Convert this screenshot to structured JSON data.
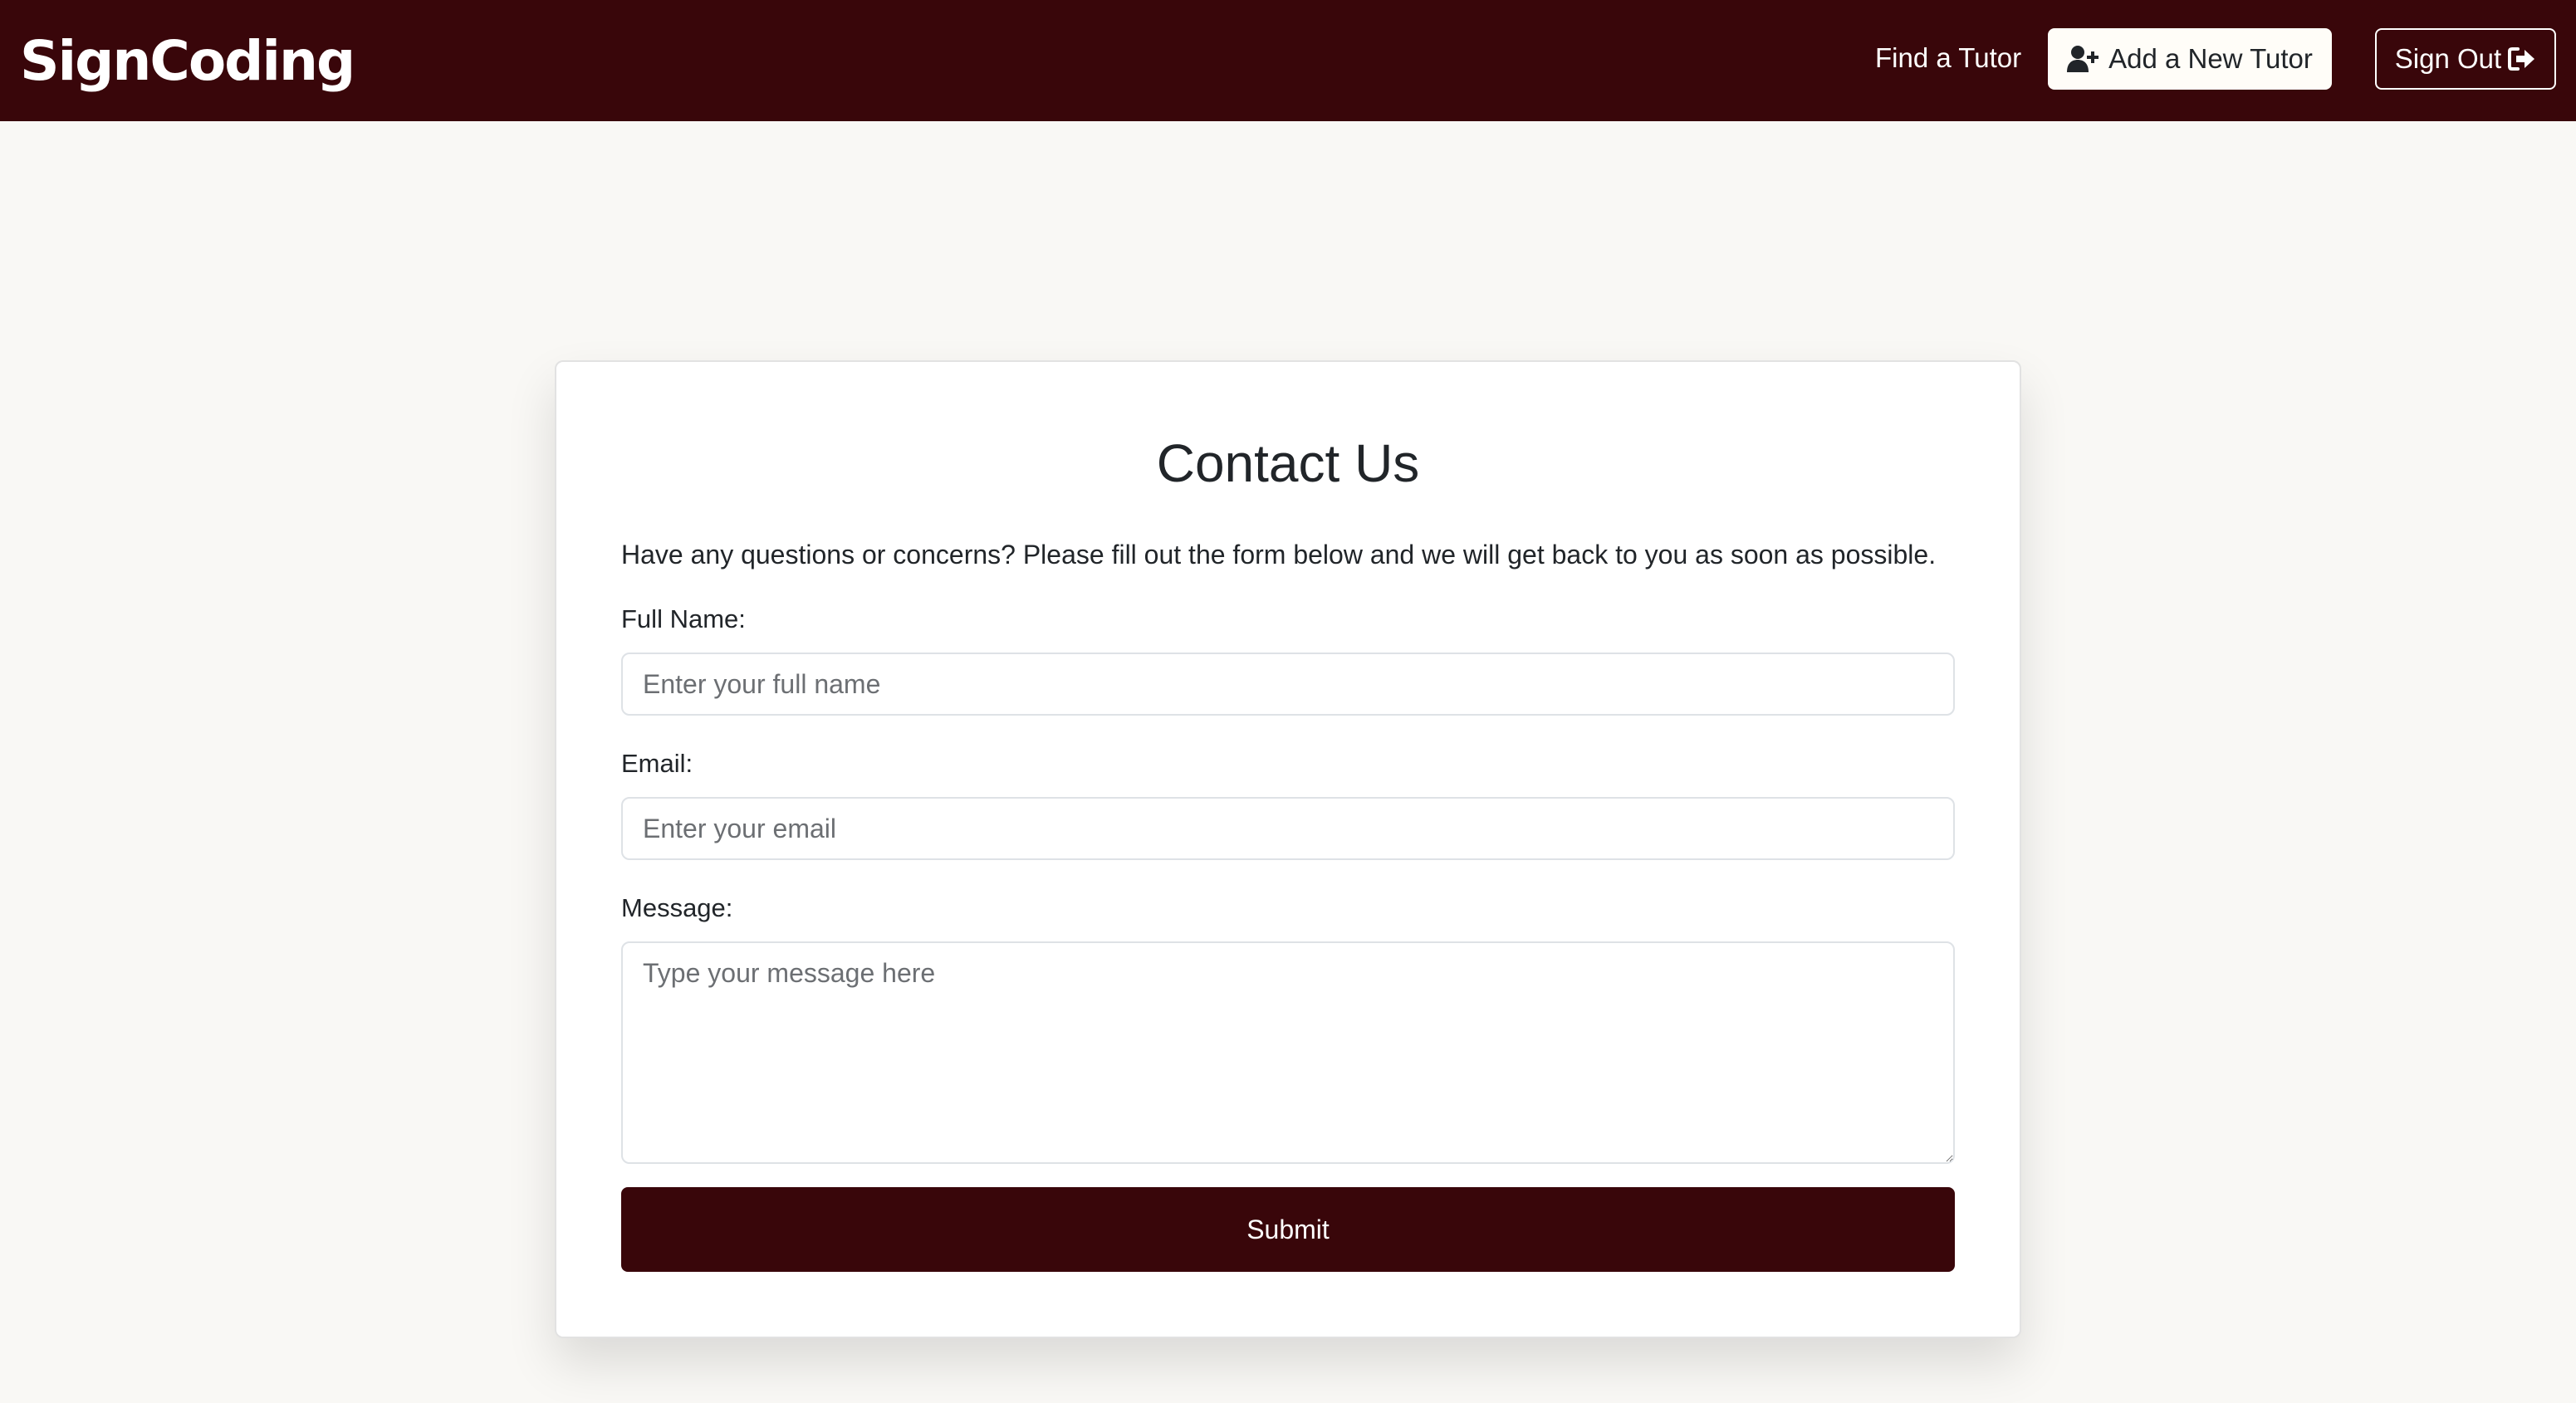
{
  "navbar": {
    "brand": "SignCoding",
    "find_tutor_label": "Find a Tutor",
    "add_tutor_label": "Add a New Tutor",
    "add_tutor_icon": "user-plus-icon",
    "sign_out_label": "Sign Out",
    "sign_out_icon": "sign-out-icon",
    "background_color": "#39060a"
  },
  "contact": {
    "title": "Contact Us",
    "intro": "Have any questions or concerns? Please fill out the form below and we will get back to you as soon as possible.",
    "full_name_label": "Full Name:",
    "full_name_placeholder": "Enter your full name",
    "full_name_value": "",
    "email_label": "Email:",
    "email_placeholder": "Enter your email",
    "email_value": "",
    "message_label": "Message:",
    "message_placeholder": "Type your message here",
    "message_value": "",
    "submit_label": "Submit"
  },
  "colors": {
    "brand": "#39060a",
    "page_background": "#f9f8f5"
  }
}
